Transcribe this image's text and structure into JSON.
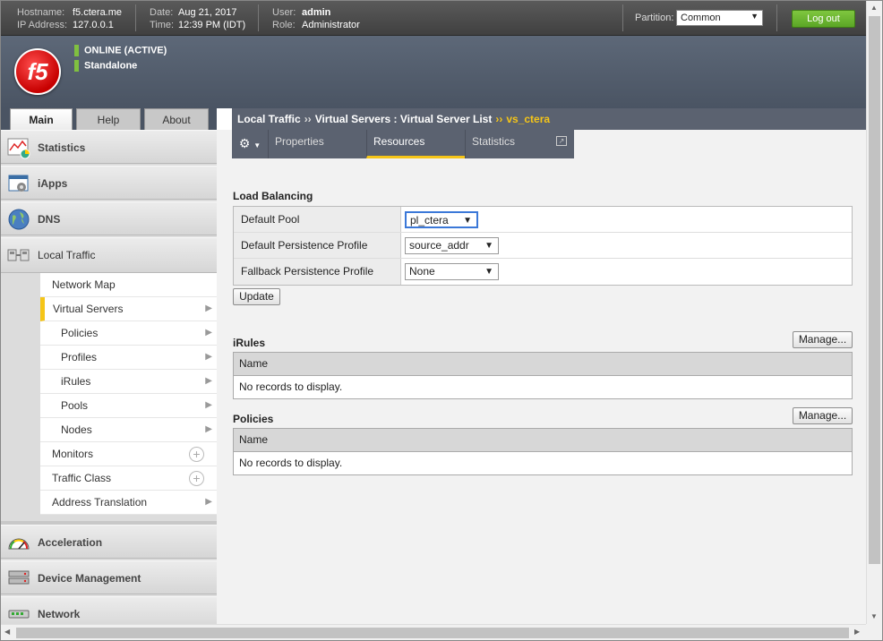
{
  "topbar": {
    "hostname_label": "Hostname:",
    "hostname": "f5.ctera.me",
    "ip_label": "IP Address:",
    "ip": "127.0.0.1",
    "date_label": "Date:",
    "date": "Aug 21, 2017",
    "time_label": "Time:",
    "time": "12:39 PM (IDT)",
    "user_label": "User:",
    "user": "admin",
    "role_label": "Role:",
    "role": "Administrator",
    "partition_label": "Partition:",
    "partition_value": "Common",
    "logout_label": "Log out"
  },
  "brand": {
    "logo_text": "f5",
    "status_online": "ONLINE (ACTIVE)",
    "status_mode": "Standalone",
    "status_color": "#80c040"
  },
  "navtabs": [
    "Main",
    "Help",
    "About"
  ],
  "sidebar": {
    "sections": [
      {
        "label": "Statistics",
        "icon": "statistics-icon"
      },
      {
        "label": "iApps",
        "icon": "iapps-icon"
      },
      {
        "label": "DNS",
        "icon": "globe-icon"
      },
      {
        "label": "Local Traffic",
        "icon": "local-traffic-icon"
      },
      {
        "label": "Acceleration",
        "icon": "gauge-icon"
      },
      {
        "label": "Device Management",
        "icon": "server-icon"
      },
      {
        "label": "Network",
        "icon": "network-icon"
      }
    ],
    "local_traffic_items": [
      "Network Map",
      "Virtual Servers",
      "Policies",
      "Profiles",
      "iRules",
      "Pools",
      "Nodes",
      "Monitors",
      "Traffic Class",
      "Address Translation"
    ]
  },
  "breadcrumb": {
    "part1": "Local Traffic",
    "part2": "Virtual Servers : Virtual Server List",
    "current": "vs_ctera",
    "separator": "››"
  },
  "subtabs": {
    "properties": "Properties",
    "resources": "Resources",
    "statistics": "Statistics"
  },
  "load_balancing": {
    "title": "Load Balancing",
    "rows": [
      {
        "label": "Default Pool",
        "value": "pl_ctera"
      },
      {
        "label": "Default Persistence Profile",
        "value": "source_addr"
      },
      {
        "label": "Fallback Persistence Profile",
        "value": "None"
      }
    ],
    "update_label": "Update"
  },
  "irules": {
    "title": "iRules",
    "manage_label": "Manage...",
    "column": "Name",
    "empty": "No records to display."
  },
  "policies": {
    "title": "Policies",
    "manage_label": "Manage...",
    "column": "Name",
    "empty": "No records to display."
  },
  "colors": {
    "accent": "#f5c518",
    "logout_green": "#5ba626",
    "header_bg": "#4a5463"
  }
}
